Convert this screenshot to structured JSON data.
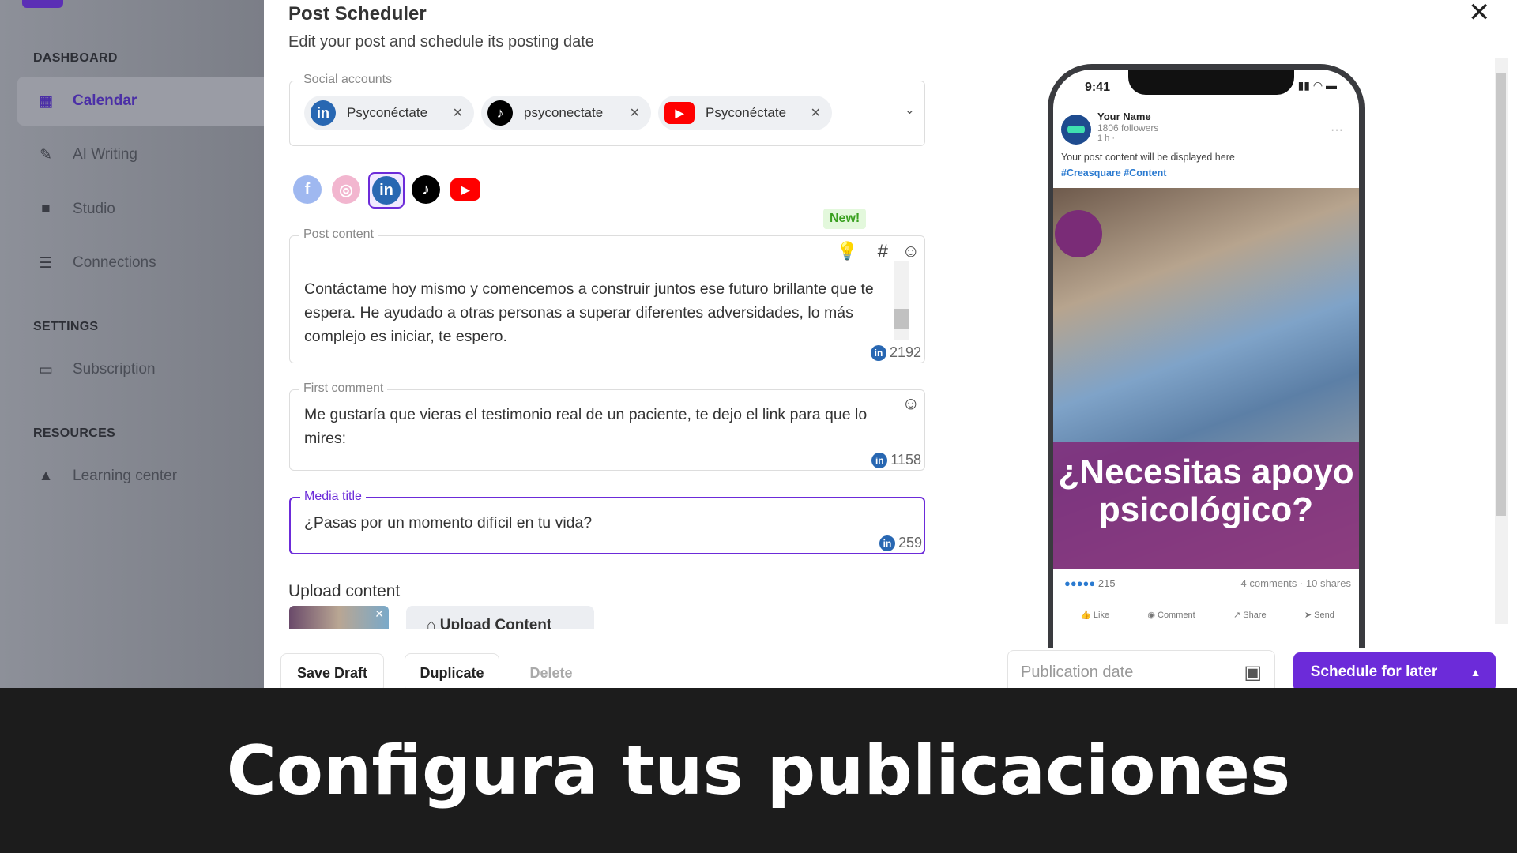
{
  "sidebar": {
    "sections": [
      {
        "title": "DASHBOARD"
      },
      {
        "title": "SETTINGS"
      },
      {
        "title": "RESOURCES"
      }
    ],
    "items": [
      {
        "label": "Calendar",
        "icon": "calendar-icon",
        "active": true
      },
      {
        "label": "AI Writing",
        "icon": "pen-icon"
      },
      {
        "label": "Studio",
        "icon": "video-camera-icon"
      },
      {
        "label": "Connections",
        "icon": "sliders-icon"
      },
      {
        "label": "Subscription",
        "icon": "credit-card-icon"
      },
      {
        "label": "Learning center",
        "icon": "shapes-icon"
      }
    ]
  },
  "modal": {
    "title": "Post Scheduler",
    "subtitle": "Edit your post and schedule its posting date",
    "social_accounts": {
      "label": "Social accounts",
      "chips": [
        {
          "network": "linkedin",
          "name": "Psyconéctate"
        },
        {
          "network": "tiktok",
          "name": "psyconectate"
        },
        {
          "network": "youtube",
          "name": "Psyconéctate"
        }
      ]
    },
    "networks": [
      "facebook",
      "instagram",
      "linkedin",
      "tiktok",
      "youtube"
    ],
    "selected_network": "linkedin",
    "new_badge": "New!",
    "post_content": {
      "label": "Post content",
      "value": "Contáctame hoy mismo y comencemos a construir juntos ese futuro brillante que te espera. He ayudado a otras personas a superar diferentes adversidades, lo más complejo es iniciar, te espero.",
      "count": "2192"
    },
    "first_comment": {
      "label": "First comment",
      "value": "Me gustaría que vieras el testimonio real de un paciente, te dejo el link para que lo mires:",
      "count": "1158"
    },
    "media_title": {
      "label": "Media title",
      "value": "¿Pasas por un momento difícil en tu vida?",
      "count": "259"
    },
    "upload": {
      "label": "Upload content",
      "button": "Upload Content"
    },
    "footer": {
      "save_draft": "Save Draft",
      "duplicate": "Duplicate",
      "delete": "Delete",
      "date_placeholder": "Publication date",
      "schedule": "Schedule for later"
    },
    "accent": "#6c2bd9"
  },
  "preview": {
    "time": "9:41",
    "name": "Your Name",
    "followers": "1806 followers",
    "ago": "1 h ·",
    "content": "Your post content will be displayed here",
    "hashtags": "#Creasquare #Content",
    "image_text": "¿Necesitas apoyo psicológico?",
    "reactions": "215",
    "stats": "4 comments · 10 shares",
    "actions": [
      "Like",
      "Comment",
      "Share",
      "Send"
    ]
  },
  "banner": "Configura tus publicaciones"
}
